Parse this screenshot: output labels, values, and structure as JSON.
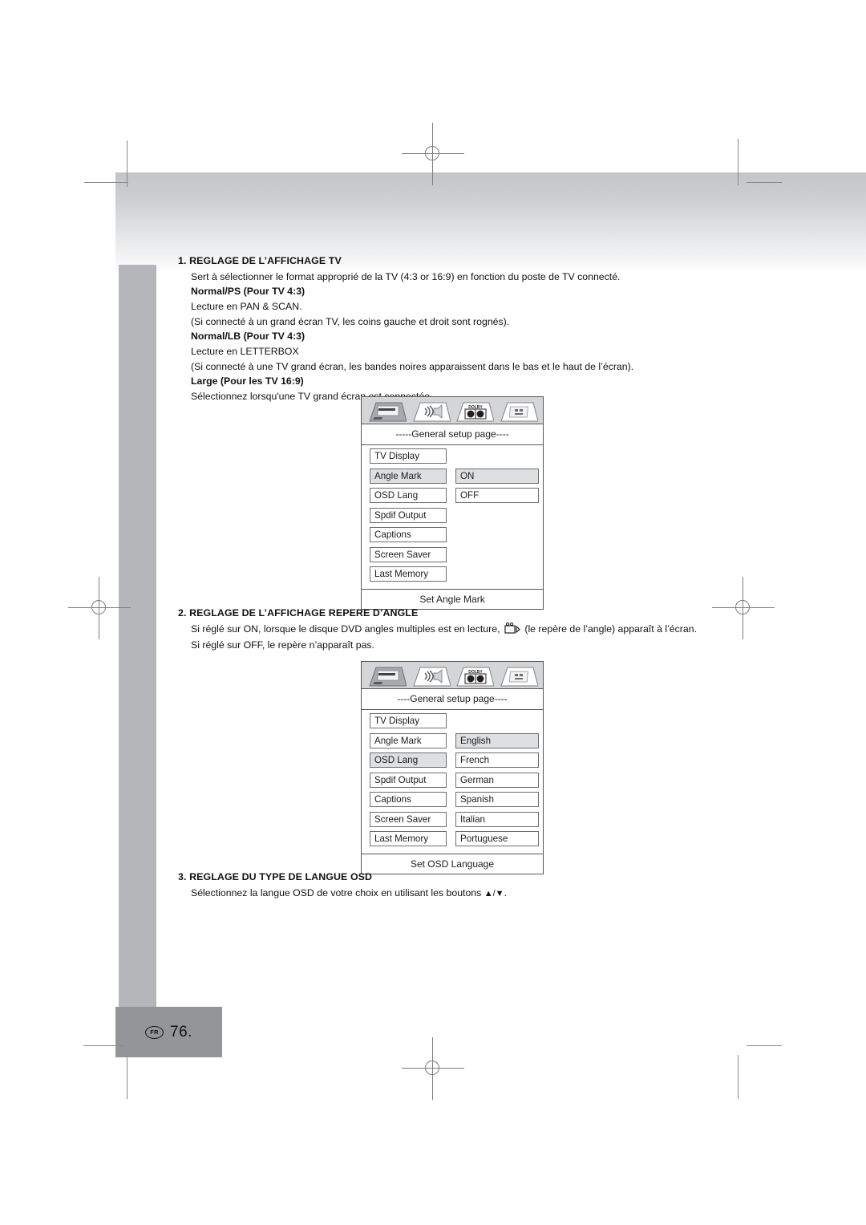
{
  "page": {
    "number": "76.",
    "locale_badge": "FR"
  },
  "sections": [
    {
      "id": "tv-display",
      "title": "1. REGLAGE DE L’AFFICHAGE TV",
      "lines": [
        {
          "text": "Sert à sélectionner le format approprié de la TV (4:3 or 16:9) en fonction du poste de TV connecté.",
          "bold": false
        },
        {
          "text": "Normal/PS (Pour TV 4:3)",
          "bold": true
        },
        {
          "text": "Lecture en PAN & SCAN.",
          "bold": false
        },
        {
          "text": "(Si connecté à un grand écran TV, les coins gauche et droit sont rognés).",
          "bold": false
        },
        {
          "text": "Normal/LB (Pour TV 4:3)",
          "bold": true
        },
        {
          "text": "Lecture en LETTERBOX",
          "bold": false
        },
        {
          "text": "(Si connecté à une TV grand écran, les bandes noires apparaissent dans le bas et le haut de l’écran).",
          "bold": false
        },
        {
          "text": "Large (Pour les TV 16:9)",
          "bold": true
        },
        {
          "text": "Sélectionnez lorsqu'une TV grand écran est connectée.",
          "bold": false
        }
      ]
    },
    {
      "id": "angle-mark",
      "title": "2. REGLAGE DE L’AFFICHAGE REPERE D’ANGLE",
      "line1_before_icon": "Si réglé sur ON, lorsque le disque DVD angles multiples est en lecture,",
      "line1_after_icon": "(le repère de l’angle) apparaît à l’écran.",
      "line2": "Si réglé sur OFF, le repère n’apparaît pas.",
      "inline_icon_name": "movie-camera-icon"
    },
    {
      "id": "osd-language",
      "title": "3. REGLAGE DU TYPE DE LANGUE OSD",
      "line1_before_arrows": "Sélectionnez la langue OSD de votre choix en utilisant les boutons",
      "arrows": "▲/▼",
      "line1_after_arrows": "."
    }
  ],
  "osd_menus": [
    {
      "id": "general-setup-angle-mark",
      "header": "-----General setup page----",
      "footer": "Set Angle Mark",
      "tabs": [
        {
          "name": "general-setup-tab-icon",
          "label": "general-setup"
        },
        {
          "name": "audio-setup-tab-icon",
          "label": "audio-setup"
        },
        {
          "name": "dolby-setup-tab-icon",
          "label": "dolby-setup"
        },
        {
          "name": "preference-setup-tab-icon",
          "label": "preference-setup"
        }
      ],
      "left_items": [
        {
          "label": "TV Display",
          "selected": false
        },
        {
          "label": "Angle Mark",
          "selected": true
        },
        {
          "label": "OSD Lang",
          "selected": false
        },
        {
          "label": "Spdif Output",
          "selected": false
        },
        {
          "label": "Captions",
          "selected": false
        },
        {
          "label": "Screen Saver",
          "selected": false
        },
        {
          "label": "Last Memory",
          "selected": false
        }
      ],
      "right_items": [
        {
          "label": "ON",
          "selected": true
        },
        {
          "label": "OFF",
          "selected": false
        }
      ],
      "right_offset_rows": 1
    },
    {
      "id": "general-setup-osd-lang",
      "header": "----General setup page----",
      "footer": "Set OSD Language",
      "tabs": [
        {
          "name": "general-setup-tab-icon",
          "label": "general-setup"
        },
        {
          "name": "audio-setup-tab-icon",
          "label": "audio-setup"
        },
        {
          "name": "dolby-setup-tab-icon",
          "label": "dolby-setup"
        },
        {
          "name": "preference-setup-tab-icon",
          "label": "preference-setup"
        }
      ],
      "left_items": [
        {
          "label": "TV Display",
          "selected": false
        },
        {
          "label": "Angle Mark",
          "selected": false
        },
        {
          "label": "OSD Lang",
          "selected": true
        },
        {
          "label": "Spdif Output",
          "selected": false
        },
        {
          "label": "Captions",
          "selected": false
        },
        {
          "label": "Screen Saver",
          "selected": false
        },
        {
          "label": "Last Memory",
          "selected": false
        }
      ],
      "right_items": [
        {
          "label": "English",
          "selected": true
        },
        {
          "label": "French",
          "selected": false
        },
        {
          "label": "German",
          "selected": false
        },
        {
          "label": "Spanish",
          "selected": false
        },
        {
          "label": "Italian",
          "selected": false
        },
        {
          "label": "Portuguese",
          "selected": false
        }
      ],
      "right_offset_rows": 1
    }
  ],
  "colors": {
    "sidebar_gray": "#b5b6b9",
    "footer_gray": "#939598",
    "menu_border": "#58585b",
    "menu_highlight": "#dedfe1",
    "iconbar_gray": "#d4d5d7"
  }
}
